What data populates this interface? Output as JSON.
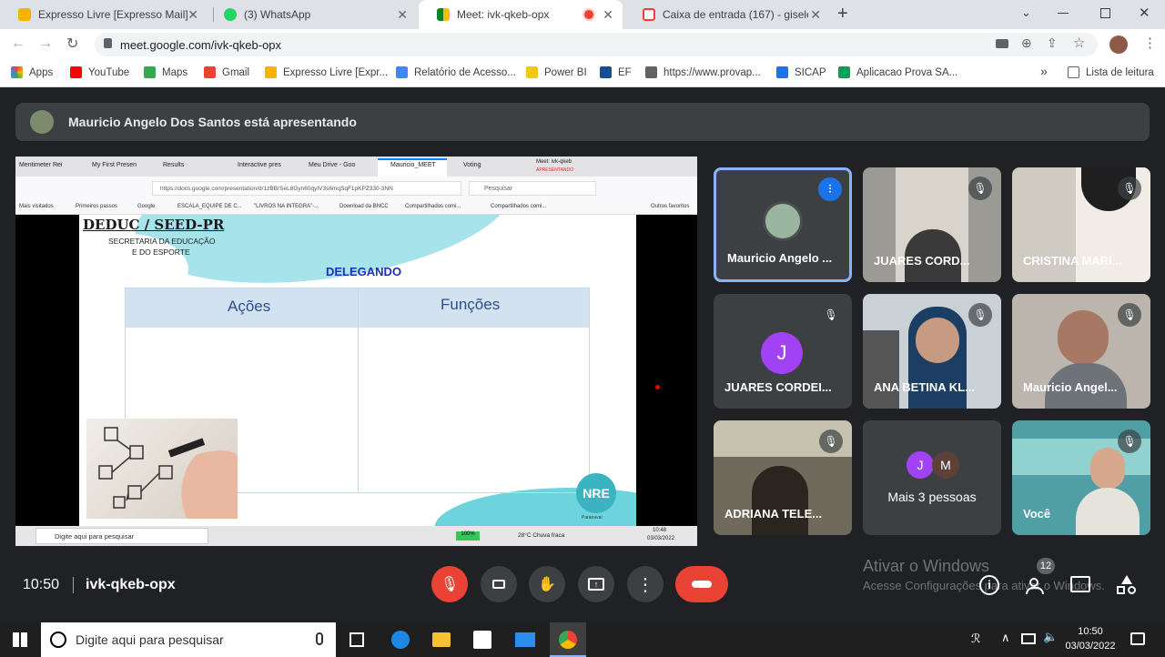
{
  "browser": {
    "tabs": [
      {
        "title": "Expresso Livre [Expresso Mail]"
      },
      {
        "title": "(3) WhatsApp"
      },
      {
        "title": "Meet: ivk-qkeb-opx"
      },
      {
        "title": "Caixa de entrada (167) - giselead"
      }
    ],
    "url": "meet.google.com/ivk-qkeb-opx",
    "bookmarks": [
      "Apps",
      "YouTube",
      "Maps",
      "Gmail",
      "Expresso Livre [Expr...",
      "Relatório de Acesso...",
      "Power BI",
      "EF",
      "https://www.provap...",
      "SICAP",
      "Aplicacao Prova SA..."
    ],
    "reading_list": "Lista de leitura"
  },
  "meet": {
    "presenter_banner": "Mauricio Angelo Dos Santos está apresentando",
    "time": "10:50",
    "meeting_code": "ivk-qkeb-opx",
    "participant_count": "12",
    "activate_windows": {
      "title": "Ativar o Windows",
      "subtitle": "Acesse Configurações para ativar o Windows."
    },
    "participants": [
      {
        "name": "Mauricio Angelo ..."
      },
      {
        "name": "JUARES CORD..."
      },
      {
        "name": "CRISTINA MARI..."
      },
      {
        "name": "JUARES CORDEI...",
        "initial": "J"
      },
      {
        "name": "ANA BETINA KL..."
      },
      {
        "name": "Mauricio Angel..."
      },
      {
        "name": "ADRIANA TELE..."
      },
      {
        "name": "Mais 3 pessoas",
        "initials": [
          "J",
          "M"
        ]
      },
      {
        "name": "Você"
      }
    ]
  },
  "shared_screen": {
    "tabs": [
      "Mentimeter Rei",
      "My First Presen",
      "Results",
      "Interactive pres",
      "Meu Drive - Goo",
      "Mauricio_MEET",
      "Voting",
      "Meet: ivk-qkeb"
    ],
    "tab_sub": "APRESENTANDO",
    "url": "https://docs.google.com/presentation/d/1zBBrSeL8Gyn60qyIV3s6mqSqF1pKPZ330-3NN",
    "search": "Pesquisar",
    "bookmarks": [
      "Mais visitados",
      "Primeiros passos",
      "Google",
      "ESCALA_EQUIPE DE C...",
      "\"LIVROS NA INTEGRA\"-...",
      "Download da BNCC",
      "Compartilhados comi...",
      "Compartilhados comi...",
      "Outros favoritos"
    ],
    "slide": {
      "header_title": "DEDUC / SEED-PR",
      "header_sub1": "SECRETARIA DA EDUCAÇÃO",
      "header_sub2": "E DO ESPORTE",
      "title": "DELEGANDO",
      "col1": "Ações",
      "col2": "Funções",
      "logo": "NRE",
      "logo_sub": "Paranavaí"
    },
    "taskbar": {
      "search": "Digite aqui para pesquisar",
      "battery": "100%",
      "weather": "28°C Chuva fraca",
      "time": "10:48",
      "date": "03/03/2022"
    }
  },
  "taskbar": {
    "search": "Digite aqui para pesquisar",
    "time": "10:50",
    "date": "03/03/2022"
  },
  "colors": {
    "end_call": "#ea4335",
    "accent": "#8ab4f8",
    "meet_bg": "#202124"
  }
}
